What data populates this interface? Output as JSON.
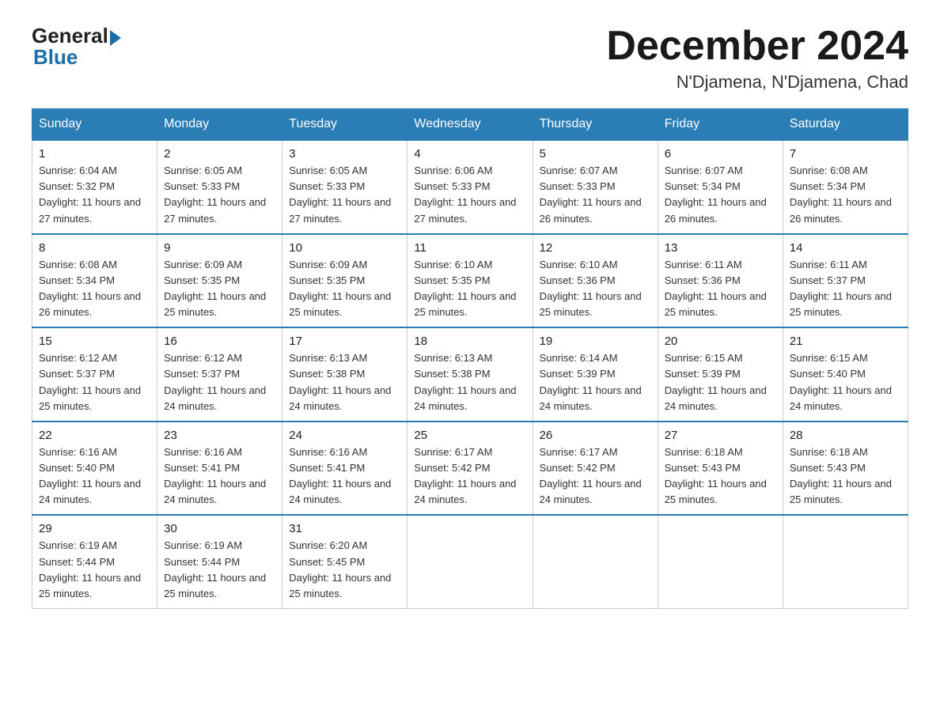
{
  "logo": {
    "general": "General",
    "blue": "Blue"
  },
  "title": "December 2024",
  "location": "N'Djamena, N'Djamena, Chad",
  "headers": [
    "Sunday",
    "Monday",
    "Tuesday",
    "Wednesday",
    "Thursday",
    "Friday",
    "Saturday"
  ],
  "weeks": [
    [
      {
        "day": "1",
        "sunrise": "6:04 AM",
        "sunset": "5:32 PM",
        "daylight": "11 hours and 27 minutes."
      },
      {
        "day": "2",
        "sunrise": "6:05 AM",
        "sunset": "5:33 PM",
        "daylight": "11 hours and 27 minutes."
      },
      {
        "day": "3",
        "sunrise": "6:05 AM",
        "sunset": "5:33 PM",
        "daylight": "11 hours and 27 minutes."
      },
      {
        "day": "4",
        "sunrise": "6:06 AM",
        "sunset": "5:33 PM",
        "daylight": "11 hours and 27 minutes."
      },
      {
        "day": "5",
        "sunrise": "6:07 AM",
        "sunset": "5:33 PM",
        "daylight": "11 hours and 26 minutes."
      },
      {
        "day": "6",
        "sunrise": "6:07 AM",
        "sunset": "5:34 PM",
        "daylight": "11 hours and 26 minutes."
      },
      {
        "day": "7",
        "sunrise": "6:08 AM",
        "sunset": "5:34 PM",
        "daylight": "11 hours and 26 minutes."
      }
    ],
    [
      {
        "day": "8",
        "sunrise": "6:08 AM",
        "sunset": "5:34 PM",
        "daylight": "11 hours and 26 minutes."
      },
      {
        "day": "9",
        "sunrise": "6:09 AM",
        "sunset": "5:35 PM",
        "daylight": "11 hours and 25 minutes."
      },
      {
        "day": "10",
        "sunrise": "6:09 AM",
        "sunset": "5:35 PM",
        "daylight": "11 hours and 25 minutes."
      },
      {
        "day": "11",
        "sunrise": "6:10 AM",
        "sunset": "5:35 PM",
        "daylight": "11 hours and 25 minutes."
      },
      {
        "day": "12",
        "sunrise": "6:10 AM",
        "sunset": "5:36 PM",
        "daylight": "11 hours and 25 minutes."
      },
      {
        "day": "13",
        "sunrise": "6:11 AM",
        "sunset": "5:36 PM",
        "daylight": "11 hours and 25 minutes."
      },
      {
        "day": "14",
        "sunrise": "6:11 AM",
        "sunset": "5:37 PM",
        "daylight": "11 hours and 25 minutes."
      }
    ],
    [
      {
        "day": "15",
        "sunrise": "6:12 AM",
        "sunset": "5:37 PM",
        "daylight": "11 hours and 25 minutes."
      },
      {
        "day": "16",
        "sunrise": "6:12 AM",
        "sunset": "5:37 PM",
        "daylight": "11 hours and 24 minutes."
      },
      {
        "day": "17",
        "sunrise": "6:13 AM",
        "sunset": "5:38 PM",
        "daylight": "11 hours and 24 minutes."
      },
      {
        "day": "18",
        "sunrise": "6:13 AM",
        "sunset": "5:38 PM",
        "daylight": "11 hours and 24 minutes."
      },
      {
        "day": "19",
        "sunrise": "6:14 AM",
        "sunset": "5:39 PM",
        "daylight": "11 hours and 24 minutes."
      },
      {
        "day": "20",
        "sunrise": "6:15 AM",
        "sunset": "5:39 PM",
        "daylight": "11 hours and 24 minutes."
      },
      {
        "day": "21",
        "sunrise": "6:15 AM",
        "sunset": "5:40 PM",
        "daylight": "11 hours and 24 minutes."
      }
    ],
    [
      {
        "day": "22",
        "sunrise": "6:16 AM",
        "sunset": "5:40 PM",
        "daylight": "11 hours and 24 minutes."
      },
      {
        "day": "23",
        "sunrise": "6:16 AM",
        "sunset": "5:41 PM",
        "daylight": "11 hours and 24 minutes."
      },
      {
        "day": "24",
        "sunrise": "6:16 AM",
        "sunset": "5:41 PM",
        "daylight": "11 hours and 24 minutes."
      },
      {
        "day": "25",
        "sunrise": "6:17 AM",
        "sunset": "5:42 PM",
        "daylight": "11 hours and 24 minutes."
      },
      {
        "day": "26",
        "sunrise": "6:17 AM",
        "sunset": "5:42 PM",
        "daylight": "11 hours and 24 minutes."
      },
      {
        "day": "27",
        "sunrise": "6:18 AM",
        "sunset": "5:43 PM",
        "daylight": "11 hours and 25 minutes."
      },
      {
        "day": "28",
        "sunrise": "6:18 AM",
        "sunset": "5:43 PM",
        "daylight": "11 hours and 25 minutes."
      }
    ],
    [
      {
        "day": "29",
        "sunrise": "6:19 AM",
        "sunset": "5:44 PM",
        "daylight": "11 hours and 25 minutes."
      },
      {
        "day": "30",
        "sunrise": "6:19 AM",
        "sunset": "5:44 PM",
        "daylight": "11 hours and 25 minutes."
      },
      {
        "day": "31",
        "sunrise": "6:20 AM",
        "sunset": "5:45 PM",
        "daylight": "11 hours and 25 minutes."
      },
      null,
      null,
      null,
      null
    ]
  ]
}
